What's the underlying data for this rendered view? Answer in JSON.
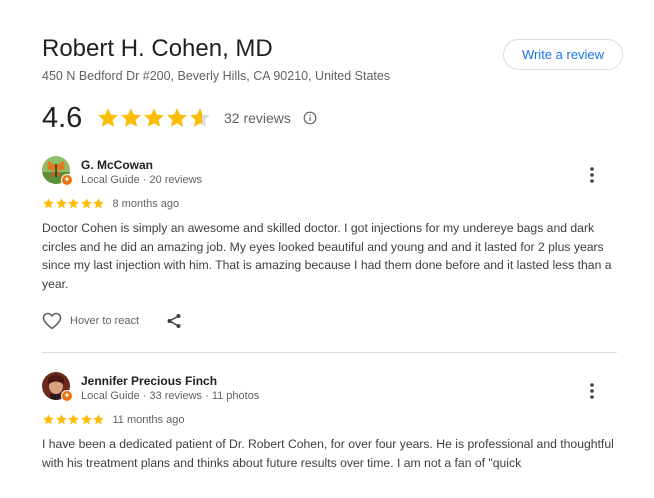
{
  "place": {
    "name": "Robert H. Cohen, MD",
    "address": "450 N Bedford Dr #200, Beverly Hills, CA 90210, United States",
    "rating": "4.6",
    "rating_value": 4.6,
    "reviews_count": "32 reviews",
    "write_review_label": "Write a review"
  },
  "colors": {
    "star": "#fbbc04",
    "star_empty": "#dadce0",
    "accent": "#1a73e8",
    "local_guide_badge": "#e8710a"
  },
  "reviews": [
    {
      "name": "G. McCowan",
      "meta": "Local Guide · 20 reviews",
      "stars": 5,
      "time": "8 months ago",
      "text": "Doctor Cohen is simply an awesome and skilled doctor. I got injections for my undereye bags and dark circles and he did an amazing job. My eyes looked beautiful and young and and it lasted for 2 plus years since my last injection with him. That is amazing because I had them done before and it lasted less than a year.",
      "react_label": "Hover to react"
    },
    {
      "name": "Jennifer Precious Finch",
      "meta": "Local Guide · 33 reviews · 11 photos",
      "stars": 5,
      "time": "11 months ago",
      "text": "I have been a dedicated patient of Dr. Robert Cohen, for over four years. He is professional and thoughtful with his treatment plans and thinks about future results over time. I am not a fan of \"quick"
    }
  ]
}
